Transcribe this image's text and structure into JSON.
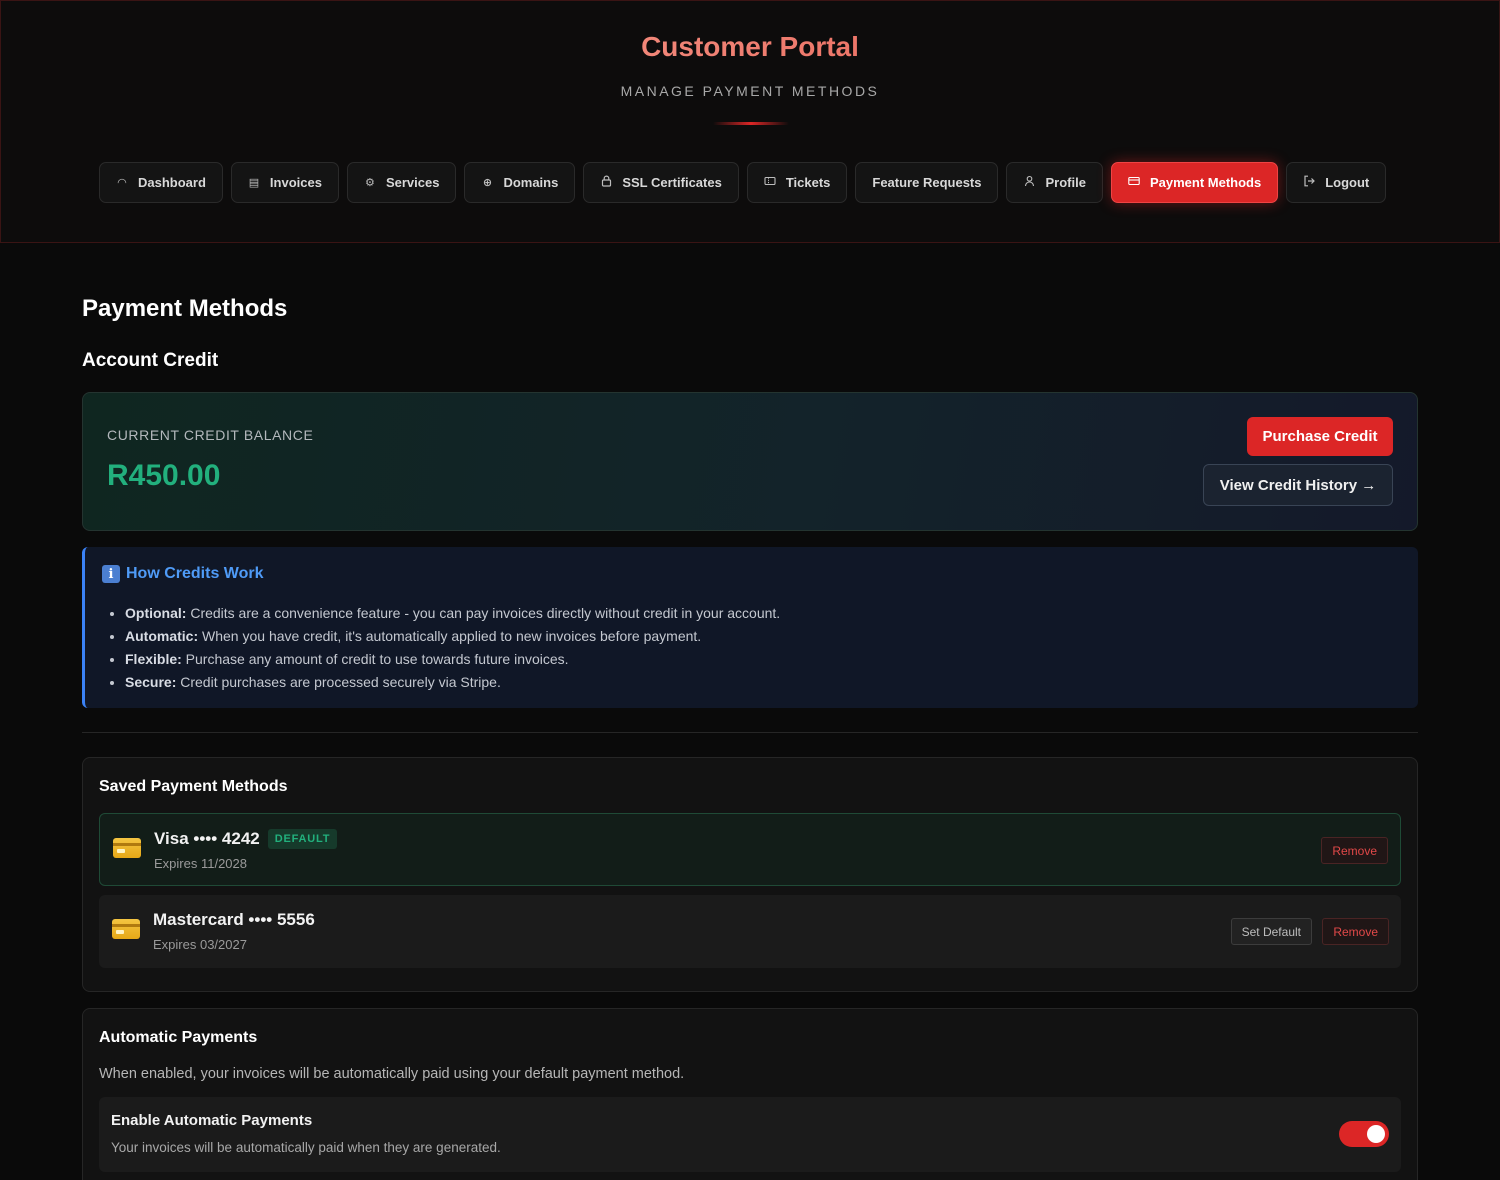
{
  "header": {
    "title": "Customer Portal",
    "subtitle": "MANAGE PAYMENT METHODS"
  },
  "nav": [
    {
      "label": "Dashboard",
      "icon": "dashboard-icon",
      "glyph": "◠"
    },
    {
      "label": "Invoices",
      "icon": "invoice-icon",
      "glyph": "▤"
    },
    {
      "label": "Services",
      "icon": "gear-icon",
      "glyph": "⚙"
    },
    {
      "label": "Domains",
      "icon": "globe-icon",
      "glyph": "⊕"
    },
    {
      "label": "SSL Certificates",
      "icon": "lock-icon",
      "glyph": "🔒︎"
    },
    {
      "label": "Tickets",
      "icon": "ticket-icon",
      "glyph": "⌧"
    },
    {
      "label": "Feature Requests",
      "icon": "",
      "glyph": ""
    },
    {
      "label": "Profile",
      "icon": "user-icon",
      "glyph": "♙"
    },
    {
      "label": "Payment Methods",
      "icon": "credit-card-icon",
      "glyph": "▭",
      "active": true
    },
    {
      "label": "Logout",
      "icon": "logout-icon",
      "glyph": "⇥"
    }
  ],
  "main": {
    "page_title": "Payment Methods",
    "credit_section_title": "Account Credit",
    "credit": {
      "label": "CURRENT CREDIT BALANCE",
      "amount": "R450.00",
      "purchase_button": "Purchase Credit",
      "history_button": "View Credit History →"
    },
    "info": {
      "title": "How Credits Work",
      "items": [
        {
          "term": "Optional:",
          "text": " Credits are a convenience feature - you can pay invoices directly without credit in your account."
        },
        {
          "term": "Automatic:",
          "text": " When you have credit, it's automatically applied to new invoices before payment."
        },
        {
          "term": "Flexible:",
          "text": " Purchase any amount of credit to use towards future invoices."
        },
        {
          "term": "Secure:",
          "text": " Credit purchases are processed securely via Stripe."
        }
      ]
    },
    "saved_methods": {
      "title": "Saved Payment Methods",
      "default_badge": "DEFAULT",
      "set_default_label": "Set Default",
      "remove_label": "Remove",
      "methods": [
        {
          "name": "Visa •••• 4242",
          "expiry": "Expires 11/2028",
          "is_default": true
        },
        {
          "name": "Mastercard •••• 5556",
          "expiry": "Expires 03/2027",
          "is_default": false
        }
      ]
    },
    "auto_payments": {
      "title": "Automatic Payments",
      "description": "When enabled, your invoices will be automatically paid using your default payment method.",
      "toggle_label": "Enable Automatic Payments",
      "toggle_sub": "Your invoices will be automatically paid when they are generated.",
      "enabled": true
    }
  },
  "colors": {
    "accent": "#dc2626",
    "credit_amount": "#22b07d",
    "info_accent": "#3b82f6"
  }
}
